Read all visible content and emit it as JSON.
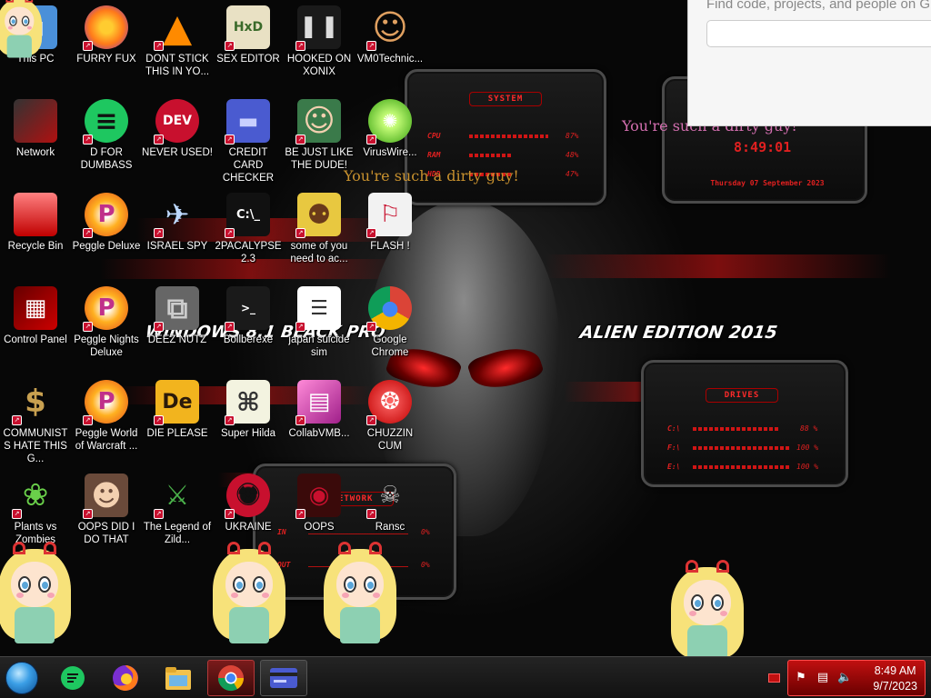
{
  "desktop": {
    "icons": [
      {
        "label": "This PC",
        "icon": "computer-icon"
      },
      {
        "label": "FURRY FUX",
        "icon": "firefox-icon"
      },
      {
        "label": "DONT STICK THIS IN YO...",
        "icon": "vlc-cone-icon"
      },
      {
        "label": "SEX EDITOR",
        "icon": "hxd-editor-icon"
      },
      {
        "label": "HOOKED ON XONIX",
        "icon": "xonix-game-icon"
      },
      {
        "label": "VM0Technic...",
        "icon": "doctor-icon"
      },
      {
        "label": "Network",
        "icon": "network-icon"
      },
      {
        "label": "D FOR DUMBASS",
        "icon": "chat-icon"
      },
      {
        "label": "NEVER USED!",
        "icon": "dev-cpp-icon"
      },
      {
        "label": "CREDIT CARD CHECKER",
        "icon": "credit-card-icon"
      },
      {
        "label": "BE JUST LIKE THE DUDE!",
        "icon": "elf-icon"
      },
      {
        "label": "VirusWire...",
        "icon": "lime-icon"
      },
      {
        "label": "Recycle Bin",
        "icon": "recycle-bin-icon"
      },
      {
        "label": "Peggle Deluxe",
        "icon": "peggle-icon"
      },
      {
        "label": "ISRAEL SPY",
        "icon": "spy-icon"
      },
      {
        "label": "2PACALYPSE 2.3",
        "icon": "terminal-icon"
      },
      {
        "label": "some of you need to ac...",
        "icon": "beaver-icon"
      },
      {
        "label": "FLASH !",
        "icon": "flash-icon"
      },
      {
        "label": "Control Panel",
        "icon": "control-panel-icon"
      },
      {
        "label": "Peggle Nights Deluxe",
        "icon": "peggle-icon"
      },
      {
        "label": "DEEZ NUTZ",
        "icon": "windows-stack-icon"
      },
      {
        "label": "Bollberexe",
        "icon": "console-icon"
      },
      {
        "label": "japan suicide sim",
        "icon": "document-icon"
      },
      {
        "label": "Google Chrome",
        "icon": "chrome-icon"
      },
      {
        "label": "COMMUNISTS HATE THIS G...",
        "icon": "money-bag-icon"
      },
      {
        "label": "Peggle World of Warcraft ...",
        "icon": "peggle-icon"
      },
      {
        "label": "DIE PLEASE",
        "icon": "director-icon"
      },
      {
        "label": "Super Hilda",
        "icon": "pixel-cat-icon"
      },
      {
        "label": "CollabVMB...",
        "icon": "collabvm-icon"
      },
      {
        "label": "CHUZZIN CUM",
        "icon": "chuzzle-icon"
      },
      {
        "label": "Plants vs Zombies",
        "icon": "plant-icon"
      },
      {
        "label": "OOPS DID I DO THAT",
        "icon": "portrait-icon"
      },
      {
        "label": "The Legend of Zild...",
        "icon": "zelda-icon"
      },
      {
        "label": "UKRAINE",
        "icon": "radiation-icon"
      },
      {
        "label": "OOPS",
        "icon": "oops-icon"
      },
      {
        "label": "Ransc",
        "icon": "ransom-icon"
      }
    ]
  },
  "wallpaper": {
    "edition_left": "WINDOWS 8.1 BLACK PRO",
    "edition_right": "ALIEN EDITION 2015",
    "system_widget": {
      "title": "SYSTEM",
      "rows": [
        {
          "label": "CPU",
          "value": "87%",
          "fill": 0.87
        },
        {
          "label": "RAM",
          "value": "48%",
          "fill": 0.48
        },
        {
          "label": "HDD",
          "value": "47%",
          "fill": 0.47
        }
      ]
    },
    "clock_widget": {
      "time": "8:49:01",
      "date": "Thursday 07 September 2023"
    },
    "drives_widget": {
      "title": "DRIVES",
      "rows": [
        {
          "label": "C:\\",
          "value": "88 %",
          "fill": 0.88
        },
        {
          "label": "F:\\",
          "value": "100 %",
          "fill": 1.0
        },
        {
          "label": "E:\\",
          "value": "100 %",
          "fill": 1.0
        }
      ]
    },
    "network_widget": {
      "title": "NETWORK",
      "rows": [
        {
          "label": "IN",
          "value": "0%"
        },
        {
          "label": "OUT",
          "value": "0%"
        }
      ]
    }
  },
  "overlay_text": [
    {
      "text": "You're such a dirty guy!",
      "color": "#d46fb0"
    },
    {
      "text": "You're such a dirty guy!",
      "color": "#c8912e"
    }
  ],
  "browser_popup": {
    "placeholder": "Find code, projects, and people on GitHub"
  },
  "taskbar": {
    "buttons": [
      {
        "name": "start-button",
        "icon": "windows-orb-icon"
      },
      {
        "name": "taskbar-chat",
        "icon": "chat-icon"
      },
      {
        "name": "taskbar-firefox",
        "icon": "firefox-icon"
      },
      {
        "name": "taskbar-explorer",
        "icon": "folder-icon"
      },
      {
        "name": "taskbar-chrome",
        "icon": "chrome-icon"
      },
      {
        "name": "taskbar-credit-card",
        "icon": "credit-card-icon"
      }
    ],
    "clock": {
      "time": "8:49 AM",
      "date": "9/7/2023"
    },
    "tray_icons": [
      "flag-icon",
      "network-icon",
      "volume-icon"
    ]
  }
}
